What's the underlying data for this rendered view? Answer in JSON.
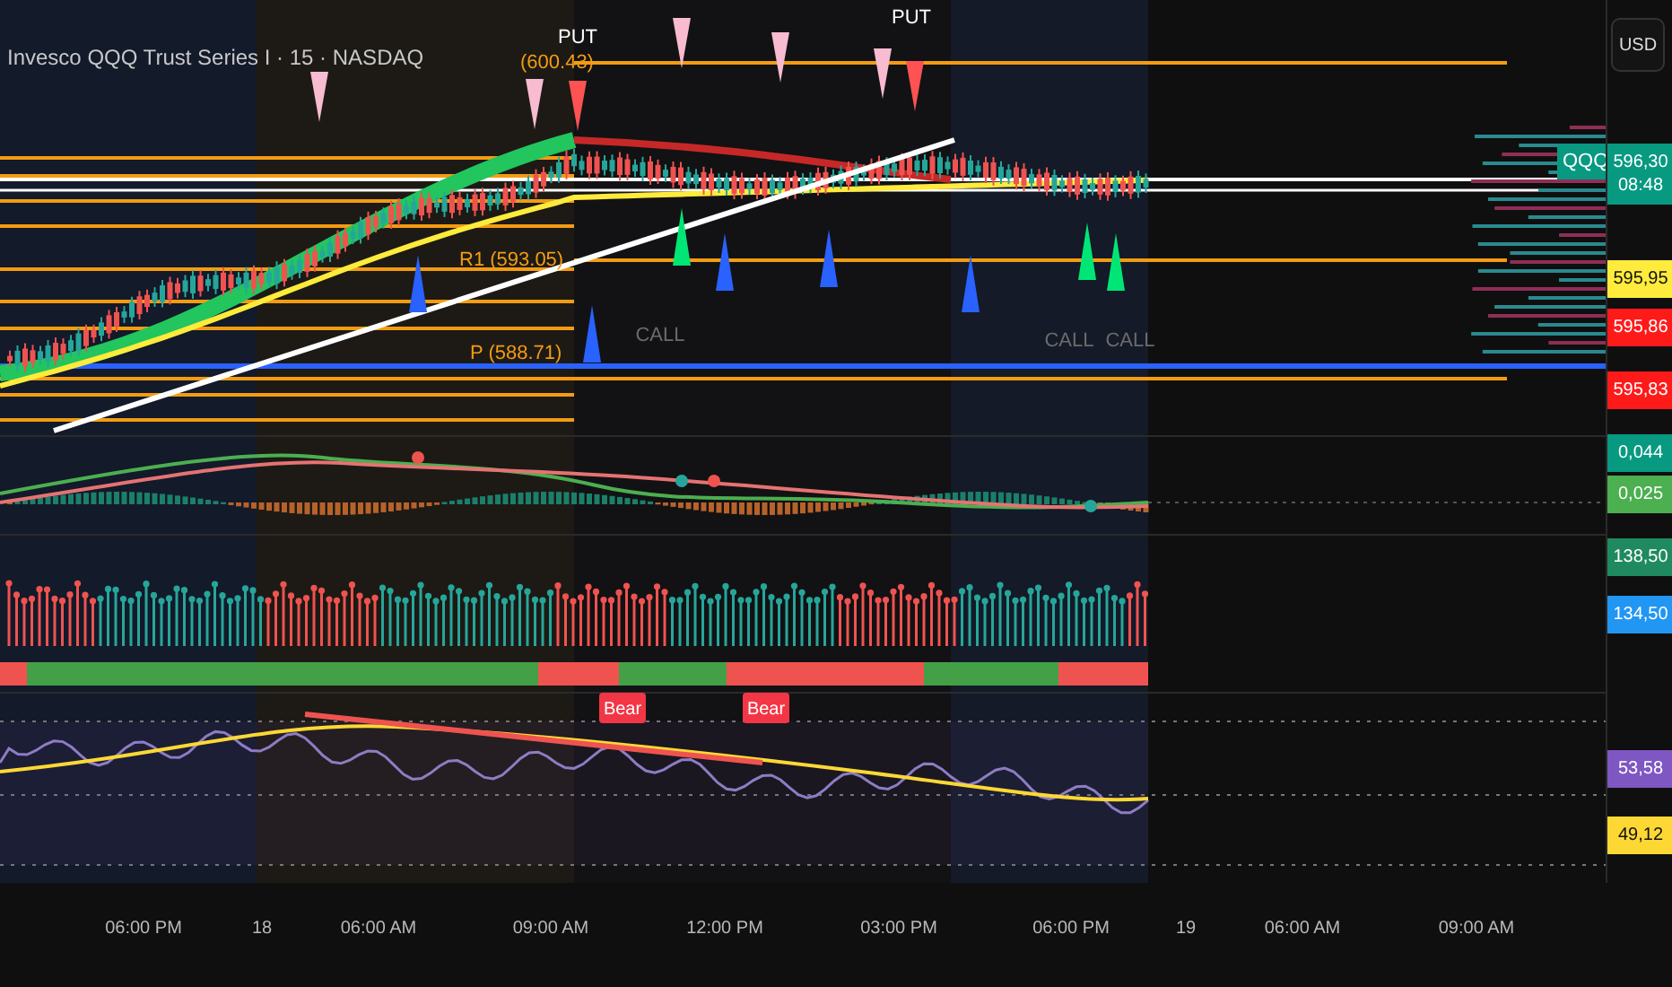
{
  "header": {
    "title": "Invesco QQQ Trust Series I · 15 · NASDAQ",
    "currency": "USD"
  },
  "price_pane": {
    "pivot_labels": [
      "(600.43)",
      "R1 (593.05)",
      "P (588.71)"
    ],
    "signals": [
      {
        "kind": "put",
        "label": "PUT"
      },
      {
        "kind": "put",
        "label": "PUT"
      },
      {
        "kind": "call",
        "label": "CALL"
      },
      {
        "kind": "call",
        "label": "CALL"
      },
      {
        "kind": "call",
        "label": "CALL"
      }
    ],
    "symbol_tag": "QQQ"
  },
  "rsi_pane": {
    "divergence_labels": [
      "Bear",
      "Bear"
    ]
  },
  "axis_tags": [
    {
      "text": "596,30",
      "subtext": "08:48",
      "color": "#089981"
    },
    {
      "text": "595,95",
      "color": "#ffeb3b"
    },
    {
      "text": "595,86",
      "color": "#ff1a1a"
    },
    {
      "text": "595,83",
      "color": "#ff1a1a"
    },
    {
      "text": "0,044",
      "color": "#089981"
    },
    {
      "text": "0,025",
      "color": "#4caf50"
    },
    {
      "text": "138,50",
      "color": "#1f8a5f"
    },
    {
      "text": "134,50",
      "color": "#2196f3"
    },
    {
      "text": "53,58",
      "color": "#7e57c2"
    },
    {
      "text": "49,12",
      "color": "#fdd835"
    }
  ],
  "time_axis": [
    "06:00 PM",
    "18",
    "06:00 AM",
    "09:00 AM",
    "12:00 PM",
    "03:00 PM",
    "06:00 PM",
    "19",
    "06:00 AM",
    "09:00 AM"
  ]
}
